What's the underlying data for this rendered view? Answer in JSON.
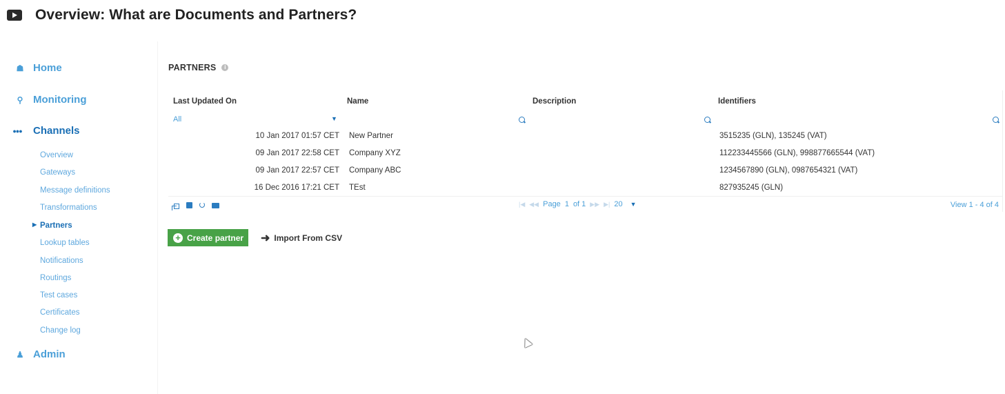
{
  "header": {
    "title": "Overview: What are Documents and Partners?",
    "icon": "video-play-icon"
  },
  "sidebar": {
    "main": [
      {
        "label": "Home",
        "icon": "home-icon"
      },
      {
        "label": "Monitoring",
        "icon": "search-icon"
      },
      {
        "label": "Channels",
        "icon": "dots-icon",
        "active": true
      },
      {
        "label": "Admin",
        "icon": "user-icon"
      }
    ],
    "channels_sub": [
      {
        "label": "Overview"
      },
      {
        "label": "Gateways"
      },
      {
        "label": "Message definitions"
      },
      {
        "label": "Transformations"
      },
      {
        "label": "Partners",
        "active": true
      },
      {
        "label": "Lookup tables"
      },
      {
        "label": "Notifications"
      },
      {
        "label": "Routings"
      },
      {
        "label": "Test cases"
      },
      {
        "label": "Certificates"
      },
      {
        "label": "Change log"
      }
    ]
  },
  "section": {
    "title": "PARTNERS",
    "info_icon": "info-icon"
  },
  "grid": {
    "columns": [
      "Last Updated On",
      "Name",
      "Description",
      "Identifiers"
    ],
    "filter": {
      "date_value": "All"
    },
    "rows": [
      {
        "date": "10 Jan 2017 01:57 CET",
        "name": "New Partner",
        "description": "",
        "identifiers": "3515235 (GLN), 135245 (VAT)"
      },
      {
        "date": "09 Jan 2017 22:58 CET",
        "name": "Company XYZ",
        "description": "",
        "identifiers": "112233445566 (GLN), 998877665544 (VAT)"
      },
      {
        "date": "09 Jan 2017 22:57 CET",
        "name": "Company ABC",
        "description": "",
        "identifiers": "1234567890 (GLN), 0987654321 (VAT)"
      },
      {
        "date": "16 Dec 2016 17:21 CET",
        "name": "TEst",
        "description": "",
        "identifiers": "827935245 (GLN)"
      }
    ],
    "pager": {
      "page_label": "Page",
      "page": "1",
      "of_label": "of 1",
      "page_size": "20",
      "view_text": "View 1 - 4 of 4"
    }
  },
  "actions": {
    "create_label": "Create partner",
    "import_label": "Import From CSV"
  },
  "colors": {
    "accent": "#4a9fd8",
    "accent_dark": "#1a6fb5",
    "create_button": "#48a247"
  }
}
